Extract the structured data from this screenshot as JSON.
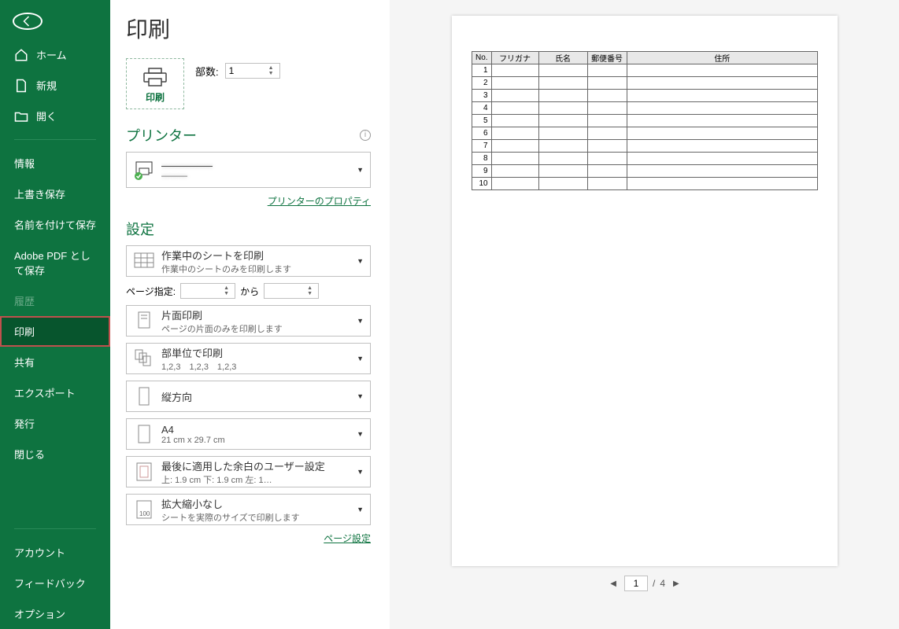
{
  "page": {
    "title": "印刷"
  },
  "nav": {
    "home": "ホーム",
    "new": "新規",
    "open": "開く",
    "info": "情報",
    "save": "上書き保存",
    "saveas": "名前を付けて保存",
    "adobe": "Adobe PDF として保存",
    "history": "履歴",
    "print": "印刷",
    "share": "共有",
    "export": "エクスポート",
    "publish": "発行",
    "close": "閉じる",
    "account": "アカウント",
    "feedback": "フィードバック",
    "options": "オプション"
  },
  "print": {
    "button_label": "印刷",
    "copies_label": "部数:",
    "copies_value": "1"
  },
  "printer_section": {
    "title": "プリンター"
  },
  "printer": {
    "name": "—————",
    "status": "———",
    "properties_link": "プリンターのプロパティ"
  },
  "settings_section": {
    "title": "設定"
  },
  "settings": {
    "what": {
      "t1": "作業中のシートを印刷",
      "t2": "作業中のシートのみを印刷します"
    },
    "page_range": {
      "label": "ページ指定:",
      "from": "",
      "to_label": "から",
      "to": ""
    },
    "duplex": {
      "t1": "片面印刷",
      "t2": "ページの片面のみを印刷します"
    },
    "collate": {
      "t1": "部単位で印刷",
      "t2": "1,2,3　1,2,3　1,2,3"
    },
    "orientation": {
      "t1": "縦方向",
      "t2": ""
    },
    "paper": {
      "t1": "A4",
      "t2": "21 cm x 29.7 cm"
    },
    "margins": {
      "t1": "最後に適用した余白のユーザー設定",
      "t2": "上: 1.9 cm 下: 1.9 cm 左: 1…"
    },
    "scale": {
      "t1": "拡大縮小なし",
      "t2": "シートを実際のサイズで印刷します"
    },
    "page_setup_link": "ページ設定"
  },
  "preview": {
    "headers": [
      "No.",
      "フリガナ",
      "氏名",
      "郵便番号",
      "住所"
    ],
    "rows": [
      1,
      2,
      3,
      4,
      5,
      6,
      7,
      8,
      9,
      10
    ]
  },
  "pager": {
    "current": "1",
    "total": "4",
    "sep": "/"
  }
}
